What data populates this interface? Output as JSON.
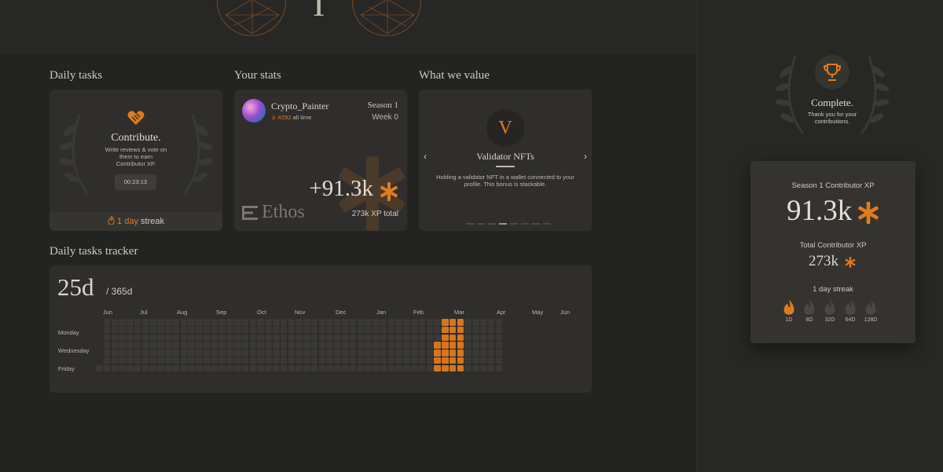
{
  "header": {
    "glyph": "I"
  },
  "sections": {
    "daily_tasks": "Daily tasks",
    "your_stats": "Your stats",
    "what_we_value": "What we value",
    "tracker": "Daily tasks tracker"
  },
  "daily_task": {
    "title": "Contribute.",
    "description": "Write reviews & vote on them to earn Contributor XP.",
    "timer": "00:23:13",
    "streak_count": "1 day",
    "streak_word": "streak"
  },
  "stats": {
    "username": "Crypto_Painter",
    "rank": "#292",
    "rank_suffix": "all time",
    "season": "Season 1",
    "week": "Week 0",
    "xp_gain": "+91.3k",
    "xp_total": "273k XP total",
    "logo": "Ethos"
  },
  "value": {
    "letter": "V",
    "title": "Validator NFTs",
    "description": "Holding a validator NFT in a wallet connected to your profile. This bonus is stackable.",
    "prev": "‹",
    "next": "›",
    "dots": 8,
    "active_dot": 3
  },
  "tracker": {
    "days": "25d",
    "total": "/ 365d",
    "months": [
      "Jun",
      "Jul",
      "Aug",
      "Sep",
      "Oct",
      "Nov",
      "Dec",
      "Jan",
      "Feb",
      "Mar",
      "Apr",
      "May",
      "Jun"
    ],
    "weekdays": [
      "Monday",
      "Wednesday",
      "Friday"
    ],
    "weeks": 53,
    "active_days": 25
  },
  "side": {
    "title": "Complete.",
    "subtitle": "Thank you for your contributions.",
    "season_xp_label": "Season 1 Contributor XP",
    "season_xp": "91.3k",
    "total_xp_label": "Total Contributor XP",
    "total_xp": "273k",
    "streak_label": "1 day streak",
    "streak_levels": [
      "1D",
      "8D",
      "32D",
      "64D",
      "128D"
    ]
  },
  "colors": {
    "accent": "#e07b1e",
    "background": "#232321",
    "card": "#2f2e2c"
  }
}
